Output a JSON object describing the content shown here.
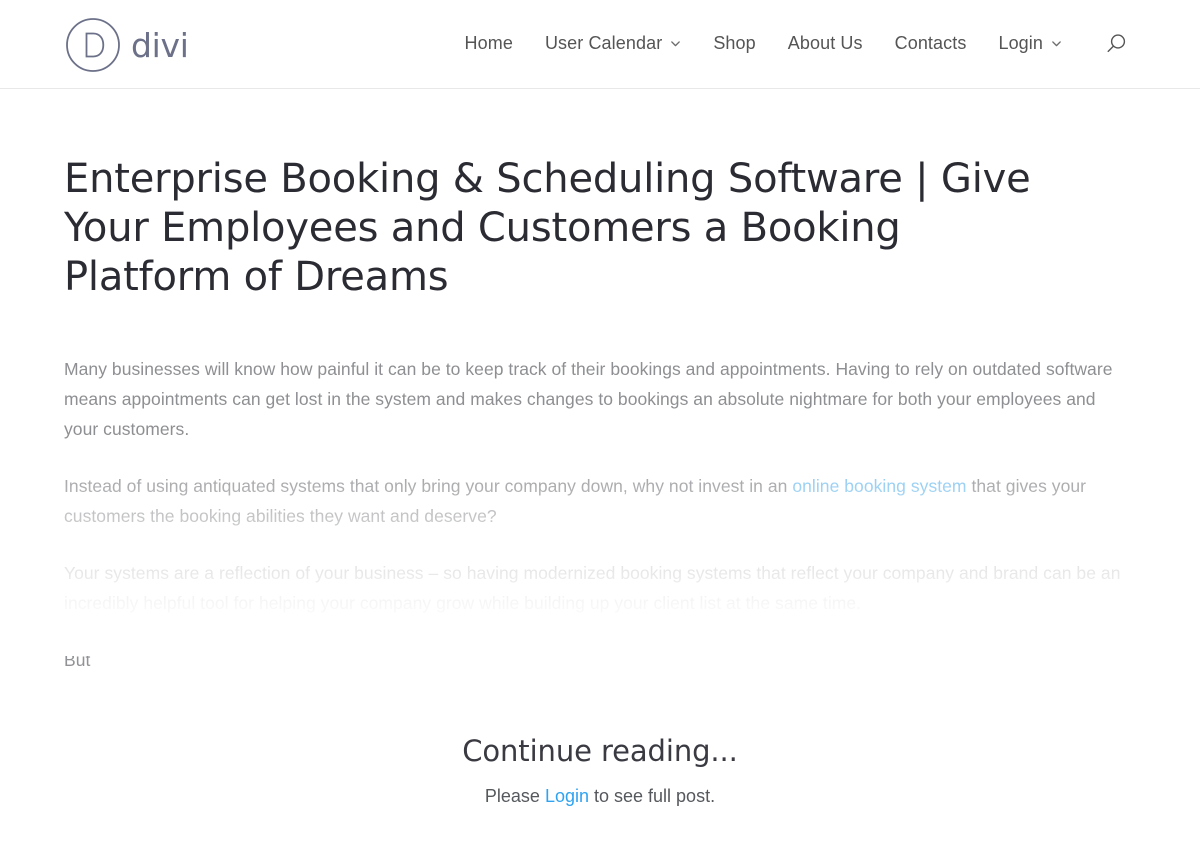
{
  "header": {
    "logo": {
      "mark_letter": "D",
      "wordmark": "divi",
      "icon": "divi-logo-icon",
      "color": "#6c7189"
    },
    "nav": [
      {
        "label": "Home",
        "has_dropdown": false
      },
      {
        "label": "User Calendar",
        "has_dropdown": true
      },
      {
        "label": "Shop",
        "has_dropdown": false
      },
      {
        "label": "About Us",
        "has_dropdown": false
      },
      {
        "label": "Contacts",
        "has_dropdown": false
      },
      {
        "label": "Login",
        "has_dropdown": true
      }
    ],
    "search_icon": "search-icon",
    "chevron_icon": "chevron-down-icon",
    "nav_text_color": "#555555",
    "border_color": "#e8e8e8"
  },
  "post": {
    "title": "Enterprise Booking & Scheduling Software | Give Your Employees and Customers a Booking Platform of Dreams",
    "paragraphs": [
      {
        "id": "p1",
        "text": "Many businesses will know how painful it can be to keep track of their bookings and appointments. Having to rely on outdated software means appointments can get lost in the system and makes changes to bookings an absolute nightmare for both your employees and your customers."
      },
      {
        "id": "p2",
        "before_link": "Instead of using antiquated systems that only bring your company down, why not invest in an ",
        "link_text": "online booking system",
        "after_link": " that gives your customers the booking abilities they want and deserve?",
        "link_color": "#7cc2f0"
      },
      {
        "id": "p3",
        "text": "Your systems are a reflection of your business – so having modernized booking systems that reflect your company and brand can be an incredibly helpful tool for helping your company grow while building up your client list at the same time."
      },
      {
        "id": "p4",
        "text": "But"
      }
    ],
    "body_text_color": "#919295",
    "title_color": "#2b2b33"
  },
  "paywall": {
    "heading": "Continue reading...",
    "prompt_before": "Please ",
    "login_label": "Login",
    "prompt_after": " to see full post.",
    "link_color": "#2ea3f2"
  }
}
